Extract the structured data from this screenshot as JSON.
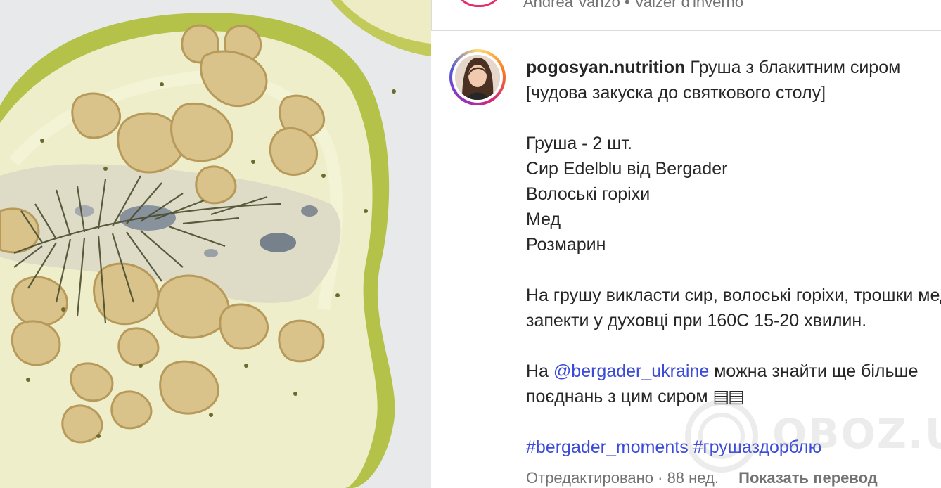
{
  "top_strip": {
    "text": "Andrea Vanzo • Valzer d'inverno"
  },
  "post": {
    "username": "pogosyan.nutrition",
    "caption_lines": [
      "Груша з блакитним сиром",
      "[чудова закуска до святкового столу]",
      "",
      "Груша - 2 шт.",
      "Сир Edelblu від Bergader",
      "Волоські горіхи",
      "Мед",
      "Розмарин",
      "",
      "На грушу викласти сир, волоські горіхи, трошки меду і",
      "запекти у духовці при 160С 15-20 хвилин.",
      ""
    ],
    "mention_prefix": "На ",
    "mention": "@bergader_ukraine",
    "mention_suffix": " можна знайти ще більше",
    "last_line": "поєднань з цим сиром ",
    "last_line_emoji": "▤▤",
    "hashtag_1": "#bergader_moments",
    "hashtag_2": "#грушаздорблю",
    "edited_label": "Отредактировано · 88 нед.",
    "translate_label": "Показать перевод"
  },
  "watermark": {
    "text": "OBOZ.UA"
  },
  "colors": {
    "link": "#3b4bd8",
    "muted": "#737373",
    "pear_skin": "#b5c24a",
    "pear_flesh": "#eeeec8"
  }
}
